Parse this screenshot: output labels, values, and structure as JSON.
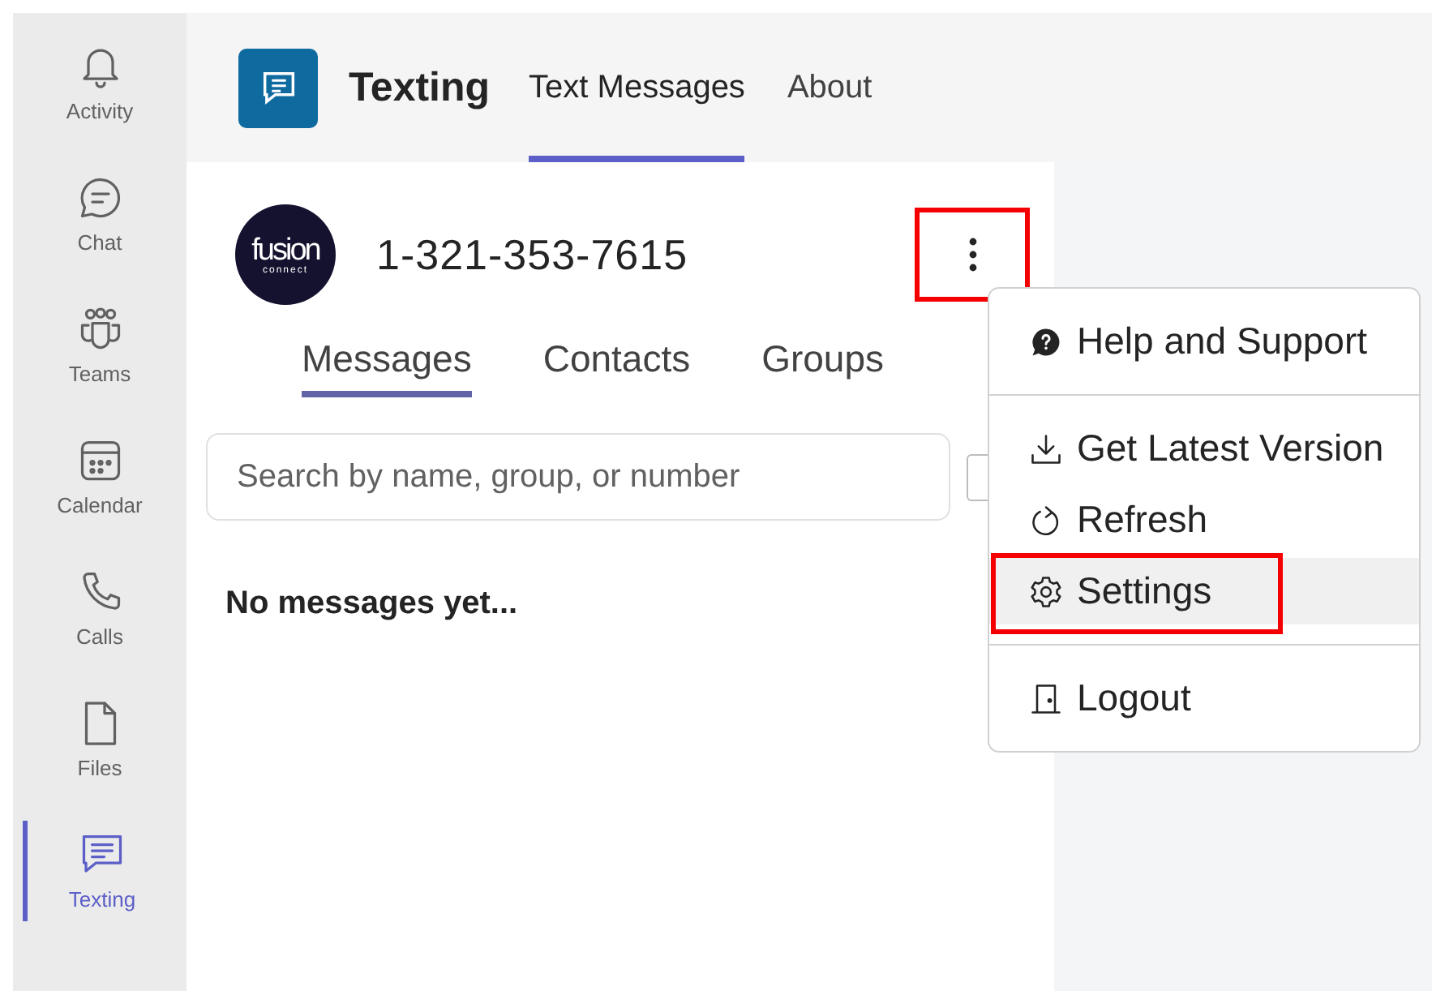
{
  "rail": {
    "items": [
      {
        "label": "Activity",
        "kind": "bell",
        "selected": false
      },
      {
        "label": "Chat",
        "kind": "chat",
        "selected": false
      },
      {
        "label": "Teams",
        "kind": "teams",
        "selected": false
      },
      {
        "label": "Calendar",
        "kind": "calendar",
        "selected": false
      },
      {
        "label": "Calls",
        "kind": "phone",
        "selected": false
      },
      {
        "label": "Files",
        "kind": "file",
        "selected": false
      },
      {
        "label": "Texting",
        "kind": "texting",
        "selected": true
      }
    ]
  },
  "header": {
    "app_name": "Texting",
    "tabs": [
      {
        "label": "Text Messages",
        "selected": true
      },
      {
        "label": "About",
        "selected": false
      }
    ]
  },
  "account": {
    "logo_text": "fusion",
    "logo_subtext": "connect",
    "phone_number": "1-321-353-7615",
    "more_button": {
      "highlighted": true
    }
  },
  "tabs": [
    {
      "label": "Messages",
      "selected": true
    },
    {
      "label": "Contacts",
      "selected": false
    },
    {
      "label": "Groups",
      "selected": false
    }
  ],
  "search": {
    "placeholder": "Search by name, group, or number"
  },
  "empty_message": "No messages yet...",
  "menu": {
    "groups": [
      [
        {
          "label": "Help and Support",
          "kind": "help",
          "hovered": false,
          "highlighted": false
        }
      ],
      [
        {
          "label": "Get Latest Version",
          "kind": "download",
          "hovered": false,
          "highlighted": false
        },
        {
          "label": "Refresh",
          "kind": "refresh",
          "hovered": false,
          "highlighted": false
        },
        {
          "label": "Settings",
          "kind": "gear",
          "hovered": true,
          "highlighted": true
        }
      ],
      [
        {
          "label": "Logout",
          "kind": "door",
          "hovered": false,
          "highlighted": false
        }
      ]
    ]
  }
}
